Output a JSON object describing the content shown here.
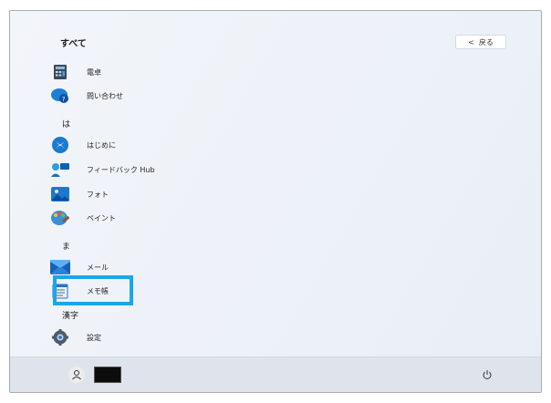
{
  "header": {
    "title": "すべて",
    "back_label": "戻る",
    "back_chevron": "<"
  },
  "items": [
    {
      "type": "app",
      "label": "電卓",
      "icon": "calculator-icon"
    },
    {
      "type": "app",
      "label": "問い合わせ",
      "icon": "help-icon"
    },
    {
      "type": "header",
      "label": "は"
    },
    {
      "type": "app",
      "label": "はじめに",
      "icon": "get-started-icon"
    },
    {
      "type": "app",
      "label": "フィードバック Hub",
      "icon": "feedback-hub-icon"
    },
    {
      "type": "app",
      "label": "フォト",
      "icon": "photos-icon"
    },
    {
      "type": "app",
      "label": "ペイント",
      "icon": "paint-icon"
    },
    {
      "type": "header",
      "label": "ま"
    },
    {
      "type": "app",
      "label": "メール",
      "icon": "mail-icon"
    },
    {
      "type": "app",
      "label": "メモ帳",
      "icon": "notepad-icon",
      "highlighted": true
    },
    {
      "type": "header",
      "label": "漢字"
    },
    {
      "type": "app",
      "label": "設定",
      "icon": "settings-icon"
    }
  ],
  "colors": {
    "highlight": "#1aa7e8",
    "footer": "#dfe4ec"
  },
  "footer": {
    "user_icon": "user-icon",
    "power_icon": "power-icon"
  }
}
